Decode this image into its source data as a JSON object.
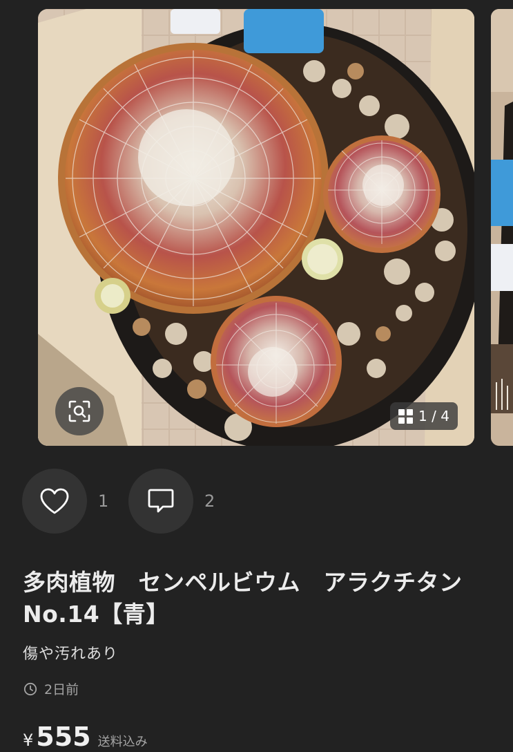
{
  "gallery": {
    "counter_text": "1 / 4",
    "current_index": 1,
    "total_images": 4
  },
  "actions": {
    "like_count": "1",
    "comment_count": "2"
  },
  "item": {
    "title": "多肉植物　センペルビウム　アラクチタン　No.14【青】",
    "condition": "傷や汚れあり",
    "posted": "2日前",
    "price_currency": "¥",
    "price_value": "555",
    "shipping_note": "送料込み"
  },
  "icons": {
    "zoom": "zoom-scan-icon",
    "gallery": "grid-icon",
    "like": "heart-icon",
    "comment": "comment-bubble-icon",
    "time": "clock-icon"
  },
  "colors": {
    "background": "#222222",
    "action_button": "#333333",
    "text_primary": "#ececec",
    "text_secondary": "#a5a5a5"
  }
}
